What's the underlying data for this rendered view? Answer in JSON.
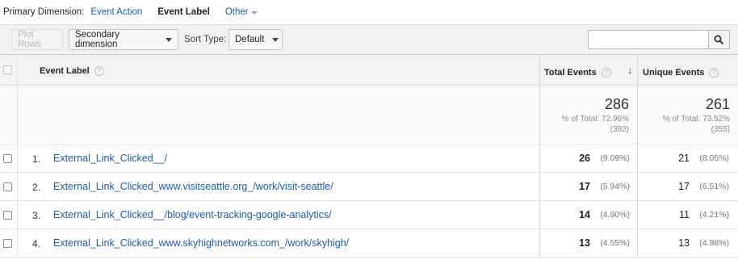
{
  "primary_dimension": {
    "label": "Primary Dimension:",
    "options": [
      "Event Action",
      "Event Label"
    ],
    "active": "Event Label",
    "other": "Other"
  },
  "toolbar": {
    "plot_rows": "Plot Rows",
    "secondary_dimension": "Secondary dimension",
    "sort_type_label": "Sort Type:",
    "sort_type_value": "Default",
    "search_placeholder": ""
  },
  "table": {
    "col_label": "Event Label",
    "col_total": "Total Events",
    "col_unique": "Unique Events",
    "help_glyph": "?",
    "sort_glyph": "↓",
    "totals": {
      "total_value": "286",
      "total_pct": "% of Total: 72.96%",
      "total_abs": "(392)",
      "unique_value": "261",
      "unique_pct": "% of Total: 73.52%",
      "unique_abs": "(355)"
    },
    "rows": [
      {
        "idx": "1.",
        "label": "External_Link_Clicked__/",
        "total": "26",
        "total_pct": "(9.09%)",
        "unique": "21",
        "unique_pct": "(8.05%)"
      },
      {
        "idx": "2.",
        "label": "External_Link_Clicked_www.visitseattle.org_/work/visit-seattle/",
        "total": "17",
        "total_pct": "(5.94%)",
        "unique": "17",
        "unique_pct": "(6.51%)"
      },
      {
        "idx": "3.",
        "label": "External_Link_Clicked__/blog/event-tracking-google-analytics/",
        "total": "14",
        "total_pct": "(4.90%)",
        "unique": "11",
        "unique_pct": "(4.21%)"
      },
      {
        "idx": "4.",
        "label": "External_Link_Clicked_www.skyhighnetworks.com_/work/skyhigh/",
        "total": "13",
        "total_pct": "(4.55%)",
        "unique": "13",
        "unique_pct": "(4.98%)"
      }
    ]
  },
  "colors": {
    "link": "#1a5ca8",
    "toolbar_bg": "#f1f1f1"
  }
}
